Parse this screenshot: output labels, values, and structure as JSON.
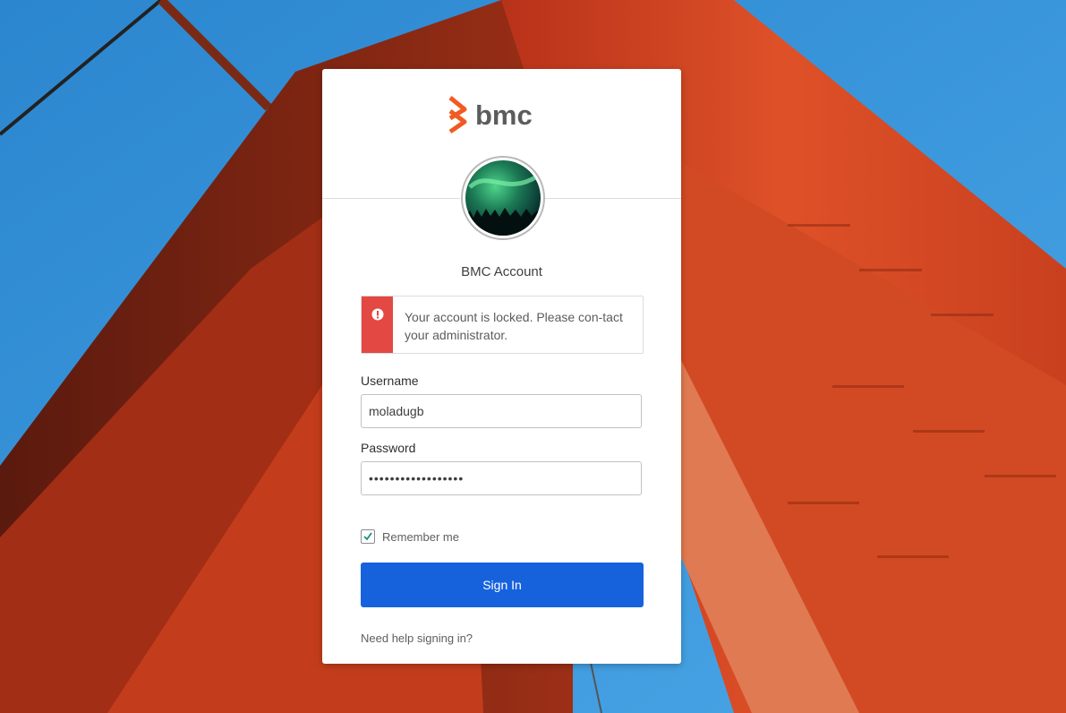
{
  "brand": {
    "logo_text": "bmc",
    "accent_color": "#f15a22"
  },
  "avatar": {
    "icon": "aurora-avatar-icon"
  },
  "account_title": "BMC Account",
  "alert": {
    "icon": "error-icon",
    "color": "#e34843",
    "message": "Your account is locked. Please con-tact your administrator."
  },
  "form": {
    "username_label": "Username",
    "username_value": "moladugb",
    "password_label": "Password",
    "password_value": "••••••••••••••••••",
    "remember_label": "Remember me",
    "remember_checked": true,
    "signin_label": "Sign In",
    "signin_color": "#1662dd",
    "help_link": "Need help signing in?"
  }
}
